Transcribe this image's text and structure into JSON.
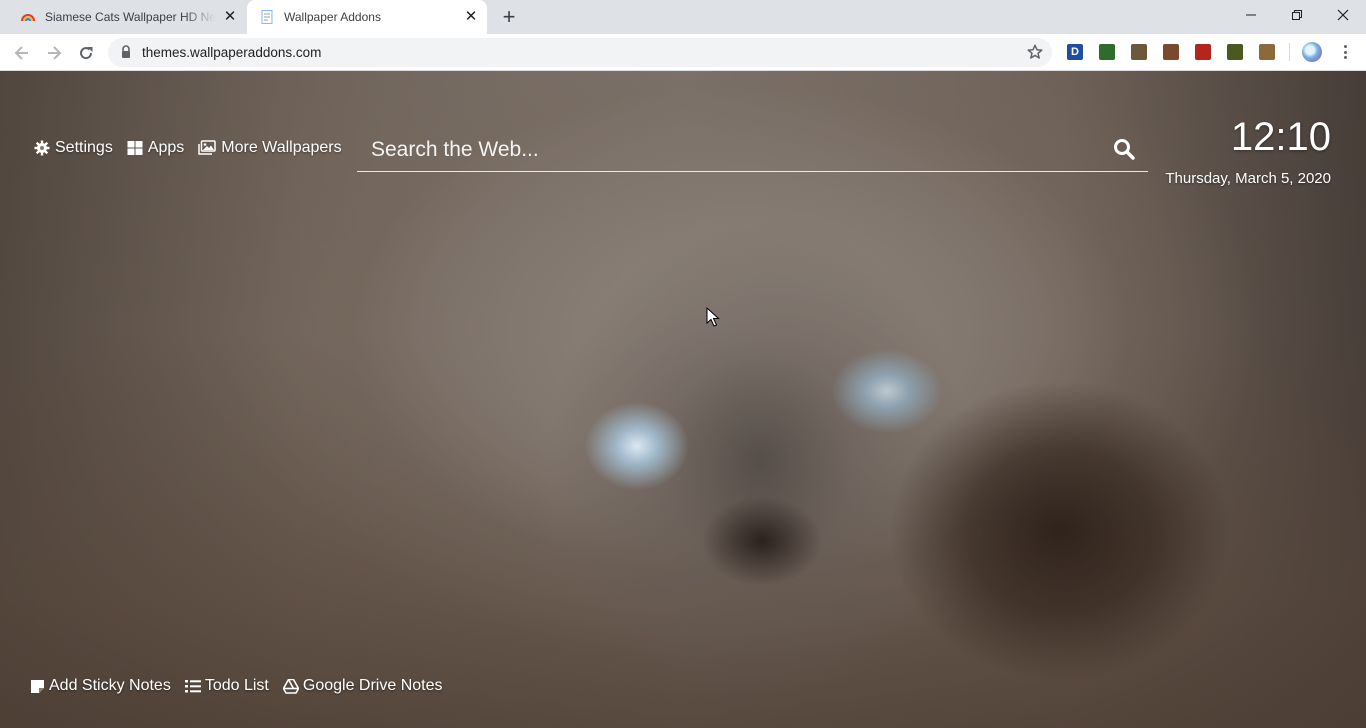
{
  "browser": {
    "tabs": [
      {
        "title": "Siamese Cats Wallpaper HD New Tab",
        "active": false,
        "favicon": "rainbow-icon"
      },
      {
        "title": "Wallpaper Addons",
        "active": true,
        "favicon": "page-icon"
      }
    ],
    "address_url": "themes.wallpaperaddons.com",
    "extensions": [
      "d-extension-icon",
      "extension-icon",
      "extension-icon",
      "extension-icon",
      "extension-icon",
      "extension-icon",
      "extension-icon"
    ],
    "extension_colors": [
      "#1f4e9c",
      "#2f6b2a",
      "#6b5a3a",
      "#7a4a2e",
      "#b3261e",
      "#4a5a1e",
      "#8a6a3a"
    ],
    "extension_d_label": "D"
  },
  "page": {
    "nav": {
      "settings": "Settings",
      "apps": "Apps",
      "more_wallpapers": "More Wallpapers"
    },
    "search": {
      "placeholder": "Search the Web..."
    },
    "clock": {
      "time": "12:10",
      "date": "Thursday, March 5, 2020"
    },
    "bottom": {
      "sticky_notes": "Add Sticky Notes",
      "todo": "Todo List",
      "drive_notes": "Google Drive Notes"
    }
  }
}
